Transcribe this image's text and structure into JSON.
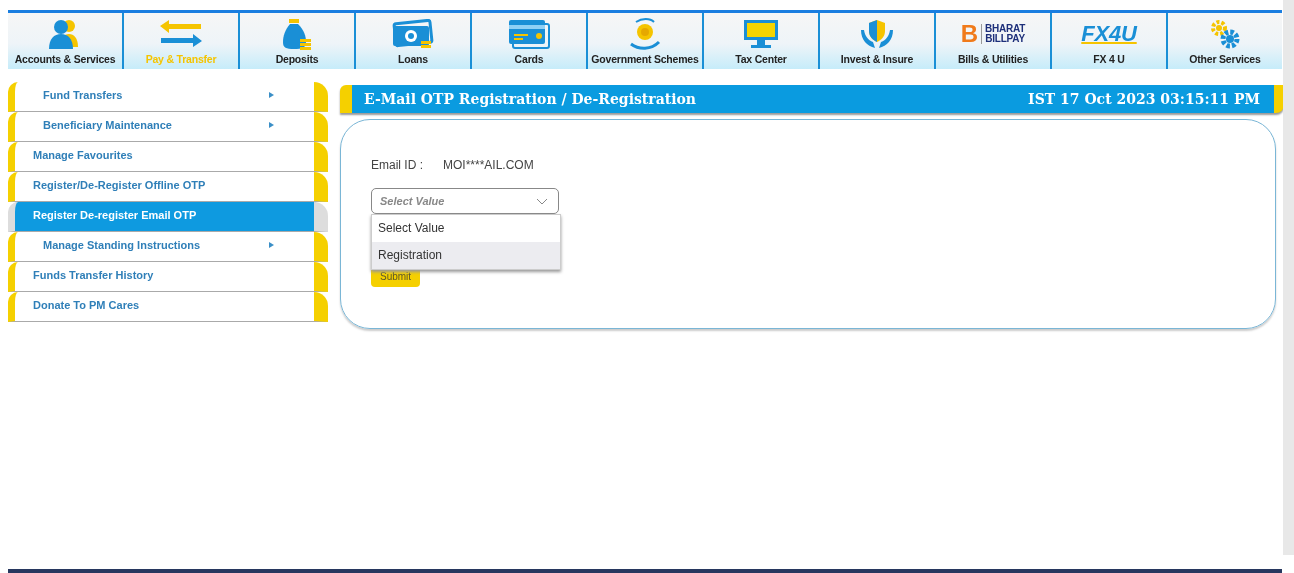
{
  "nav": [
    {
      "label": "Accounts & Services",
      "selected": false
    },
    {
      "label": "Pay & Transfer",
      "selected": true
    },
    {
      "label": "Deposits",
      "selected": false
    },
    {
      "label": "Loans",
      "selected": false
    },
    {
      "label": "Cards",
      "selected": false
    },
    {
      "label": "Government Schemes",
      "selected": false
    },
    {
      "label": "Tax Center",
      "selected": false
    },
    {
      "label": "Invest & Insure",
      "selected": false
    },
    {
      "label": "Bills & Utilities",
      "selected": false
    },
    {
      "label": "FX 4 U",
      "selected": false
    },
    {
      "label": "Other Services",
      "selected": false
    }
  ],
  "bharat_logo": {
    "letter": "B",
    "line1": "BHARAT",
    "line2": "BILLPAY"
  },
  "fx_logo": "FX4U",
  "sidebar": {
    "items": [
      {
        "label": "Fund Transfers",
        "submenu": true,
        "selected": false
      },
      {
        "label": "Beneficiary Maintenance",
        "submenu": true,
        "selected": false
      },
      {
        "label": "Manage Favourites",
        "submenu": false,
        "selected": false
      },
      {
        "label": "Register/De-Register Offline OTP",
        "submenu": false,
        "selected": false
      },
      {
        "label": "Register De-register Email OTP",
        "submenu": false,
        "selected": true
      },
      {
        "label": "Manage Standing Instructions",
        "submenu": true,
        "selected": false
      },
      {
        "label": "Funds Transfer History",
        "submenu": false,
        "selected": false
      },
      {
        "label": "Donate To PM Cares",
        "submenu": false,
        "selected": false
      }
    ]
  },
  "panel": {
    "title": "E-Mail OTP Registration / De-Registration",
    "datetime": "IST 17 Oct 2023 03:15:11 PM"
  },
  "form": {
    "email_label": "Email ID :",
    "email_value": "MOI****AIL.COM",
    "select": {
      "placeholder": "Select Value",
      "expanded": true,
      "options": [
        {
          "label": "Select Value",
          "highlighted": false
        },
        {
          "label": "Registration",
          "highlighted": true
        }
      ]
    },
    "submit": "Submit"
  }
}
